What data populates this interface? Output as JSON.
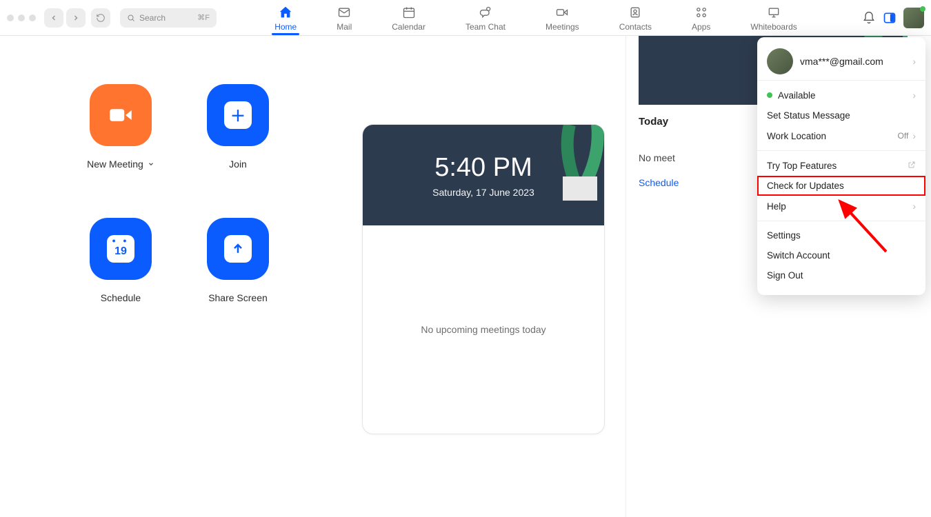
{
  "topbar": {
    "search_placeholder": "Search",
    "search_shortcut": "⌘F",
    "tabs": [
      {
        "label": "Home"
      },
      {
        "label": "Mail"
      },
      {
        "label": "Calendar"
      },
      {
        "label": "Team Chat"
      },
      {
        "label": "Meetings"
      },
      {
        "label": "Contacts"
      },
      {
        "label": "Apps"
      },
      {
        "label": "Whiteboards"
      }
    ]
  },
  "actions": {
    "new_meeting": "New Meeting",
    "join": "Join",
    "schedule": "Schedule",
    "share_screen": "Share Screen",
    "calendar_day": "19"
  },
  "card": {
    "time": "5:40 PM",
    "date": "Saturday, 17 June 2023",
    "no_meetings": "No upcoming meetings today"
  },
  "side": {
    "today": "Today",
    "no_meet": "No meet",
    "schedule_link": "Schedule"
  },
  "dropdown": {
    "email": "vma***@gmail.com",
    "available": "Available",
    "set_status": "Set Status Message",
    "work_location": "Work Location",
    "work_location_value": "Off",
    "top_features": "Try Top Features",
    "check_updates": "Check for Updates",
    "help": "Help",
    "settings": "Settings",
    "switch_account": "Switch Account",
    "sign_out": "Sign Out"
  }
}
